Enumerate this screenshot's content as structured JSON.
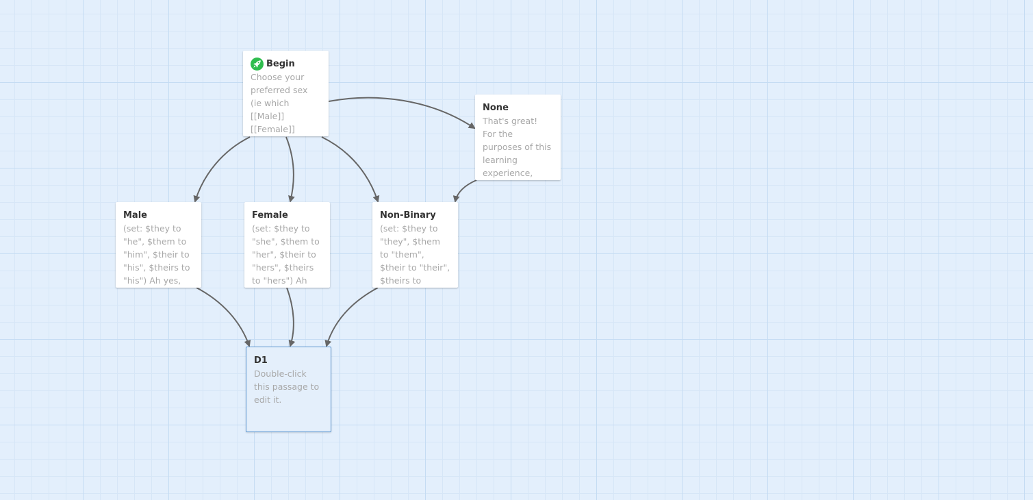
{
  "passages": [
    {
      "id": "begin",
      "title": "Begin",
      "start": true,
      "excerpt": "Choose your preferred sex (ie which [[Male]] [[Female]] [[Non-Binary]]"
    },
    {
      "id": "none",
      "title": "None",
      "start": false,
      "excerpt": "That's great! For the purposes of this learning experience,"
    },
    {
      "id": "male",
      "title": "Male",
      "start": false,
      "excerpt": "(set: $they to \"he\", $them to \"him\", $their to \"his\", $theirs to \"his\") Ah yes,"
    },
    {
      "id": "female",
      "title": "Female",
      "start": false,
      "excerpt": "(set: $they to \"she\", $them to \"her\", $their to \"hers\", $theirs to \"hers\") Ah"
    },
    {
      "id": "non_binary",
      "title": "Non-Binary",
      "start": false,
      "excerpt": "(set: $they to \"they\", $them to \"them\", $their to \"their\", $theirs to"
    },
    {
      "id": "d1",
      "title": "D1",
      "start": false,
      "selected": true,
      "excerpt": "Double-click this passage to edit it."
    }
  ],
  "links": [
    {
      "from": "Begin",
      "to": "None"
    },
    {
      "from": "Begin",
      "to": "Male"
    },
    {
      "from": "Begin",
      "to": "Female"
    },
    {
      "from": "Begin",
      "to": "Non-Binary"
    },
    {
      "from": "None",
      "to": "Non-Binary"
    },
    {
      "from": "Male",
      "to": "D1"
    },
    {
      "from": "Female",
      "to": "D1"
    },
    {
      "from": "Non-Binary",
      "to": "D1"
    }
  ],
  "icons": {
    "start": "rocket-icon"
  },
  "colors": {
    "background": "#e3effc",
    "grid_major": "#c5dcf3",
    "grid_minor": "#d6e6f7",
    "link": "#666666",
    "start_badge": "#2fbd4e",
    "selected_border": "#5a95d1"
  }
}
